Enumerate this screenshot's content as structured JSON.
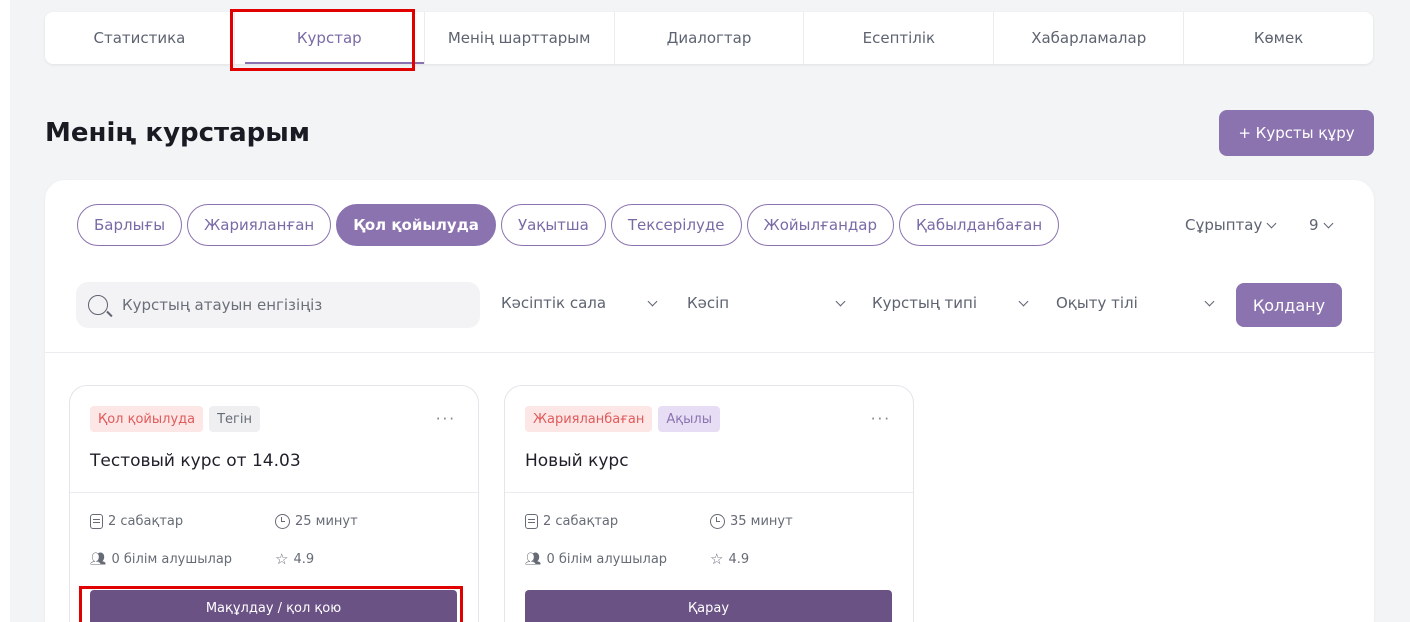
{
  "nav": {
    "tabs": [
      {
        "label": "Статистика"
      },
      {
        "label": "Курстар"
      },
      {
        "label": "Менің шарттарым"
      },
      {
        "label": "Диалогтар"
      },
      {
        "label": "Есептілік"
      },
      {
        "label": "Хабарламалар"
      },
      {
        "label": "Көмек"
      }
    ],
    "active_index": 1
  },
  "page": {
    "title": "Менің курстарым",
    "create_button": "+ Курсты құру"
  },
  "filters": {
    "chips": [
      {
        "label": "Барлығы"
      },
      {
        "label": "Жарияланған"
      },
      {
        "label": "Қол қойылуда"
      },
      {
        "label": "Уақытша"
      },
      {
        "label": "Тексерілуде"
      },
      {
        "label": "Жойылғандар"
      },
      {
        "label": "Қабылданбаған"
      }
    ],
    "active_chip": 2,
    "sort_label": "Сұрыптау",
    "per_page": "9",
    "search_placeholder": "Курстың атауын енгізіңіз",
    "dropdowns": [
      {
        "label": "Кәсіптік сала"
      },
      {
        "label": "Кәсіп"
      },
      {
        "label": "Курстың типі"
      },
      {
        "label": "Оқыту тілі"
      }
    ],
    "apply_button": "Қолдану"
  },
  "courses": [
    {
      "status_badge": "Қол қойылуда",
      "price_badge": "Тегін",
      "title": "Тестовый курс от 14.03",
      "lessons": "2 сабақтар",
      "duration": "25 минут",
      "students": "0 білім алушылар",
      "rating": "4.9",
      "action_button": "Мақұлдау / қол қою"
    },
    {
      "status_badge": "Жарияланбаған",
      "price_badge": "Ақылы",
      "title": "Новый курс",
      "lessons": "2 сабақтар",
      "duration": "35 минут",
      "students": "0 білім алушылар",
      "rating": "4.9",
      "action_button": "Қарау"
    }
  ],
  "colors": {
    "accent": "#8b73b0",
    "button_dark": "#6b5285",
    "highlight": "#e00000"
  }
}
